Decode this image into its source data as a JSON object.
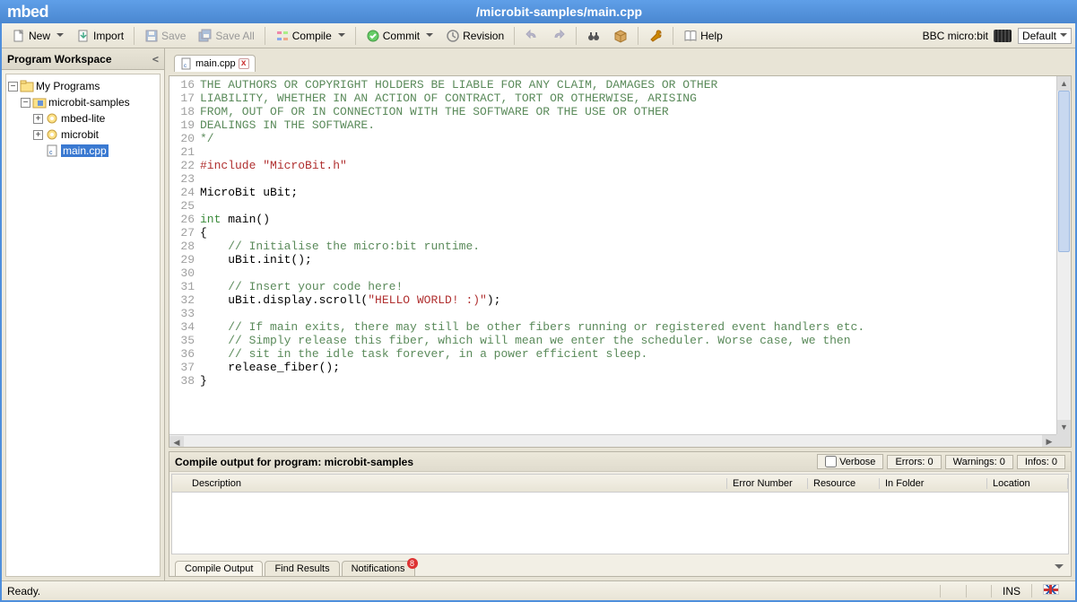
{
  "titlebar": {
    "logo": "mbed",
    "path": "/microbit-samples/main.cpp"
  },
  "toolbar": {
    "new": "New",
    "import": "Import",
    "save": "Save",
    "saveall": "Save All",
    "compile": "Compile",
    "commit": "Commit",
    "revision": "Revision",
    "help": "Help",
    "device": "BBC micro:bit",
    "profile": "Default"
  },
  "sidebar": {
    "title": "Program Workspace",
    "root": "My Programs",
    "proj": "microbit-samples",
    "items": [
      "mbed-lite",
      "microbit",
      "main.cpp"
    ]
  },
  "tab": {
    "name": "main.cpp"
  },
  "code": [
    {
      "n": 16,
      "t": "THE AUTHORS OR COPYRIGHT HOLDERS BE LIABLE FOR ANY CLAIM, DAMAGES OR OTHER",
      "c": "cm"
    },
    {
      "n": 17,
      "t": "LIABILITY, WHETHER IN AN ACTION OF CONTRACT, TORT OR OTHERWISE, ARISING",
      "c": "cm"
    },
    {
      "n": 18,
      "t": "FROM, OUT OF OR IN CONNECTION WITH THE SOFTWARE OR THE USE OR OTHER",
      "c": "cm"
    },
    {
      "n": 19,
      "t": "DEALINGS IN THE SOFTWARE.",
      "c": "cm"
    },
    {
      "n": 20,
      "t": "*/",
      "c": "cm"
    },
    {
      "n": 21,
      "t": "",
      "c": ""
    },
    {
      "n": 22,
      "seg": [
        {
          "t": "#include ",
          "c": "pp"
        },
        {
          "t": "\"MicroBit.h\"",
          "c": "pp"
        }
      ]
    },
    {
      "n": 23,
      "t": "",
      "c": ""
    },
    {
      "n": 24,
      "t": "MicroBit uBit;",
      "c": ""
    },
    {
      "n": 25,
      "t": "",
      "c": ""
    },
    {
      "n": 26,
      "seg": [
        {
          "t": "int",
          "c": "kw"
        },
        {
          "t": " main()",
          "c": ""
        }
      ]
    },
    {
      "n": 27,
      "t": "{",
      "c": ""
    },
    {
      "n": 28,
      "seg": [
        {
          "t": "    ",
          "c": ""
        },
        {
          "t": "// Initialise the micro:bit runtime.",
          "c": "cm"
        }
      ]
    },
    {
      "n": 29,
      "t": "    uBit.init();",
      "c": ""
    },
    {
      "n": 30,
      "t": "",
      "c": ""
    },
    {
      "n": 31,
      "seg": [
        {
          "t": "    ",
          "c": ""
        },
        {
          "t": "// Insert your code here!",
          "c": "cm"
        }
      ]
    },
    {
      "n": 32,
      "seg": [
        {
          "t": "    uBit.display.scroll(",
          "c": ""
        },
        {
          "t": "\"HELLO WORLD! :)\"",
          "c": "st"
        },
        {
          "t": ");",
          "c": ""
        }
      ]
    },
    {
      "n": 33,
      "t": "",
      "c": ""
    },
    {
      "n": 34,
      "seg": [
        {
          "t": "    ",
          "c": ""
        },
        {
          "t": "// If main exits, there may still be other fibers running or registered event handlers etc.",
          "c": "cm"
        }
      ]
    },
    {
      "n": 35,
      "seg": [
        {
          "t": "    ",
          "c": ""
        },
        {
          "t": "// Simply release this fiber, which will mean we enter the scheduler. Worse case, we then",
          "c": "cm"
        }
      ]
    },
    {
      "n": 36,
      "seg": [
        {
          "t": "    ",
          "c": ""
        },
        {
          "t": "// sit in the idle task forever, in a power efficient sleep.",
          "c": "cm"
        }
      ]
    },
    {
      "n": 37,
      "t": "    release_fiber();",
      "c": ""
    },
    {
      "n": 38,
      "t": "}",
      "c": ""
    }
  ],
  "output": {
    "title_prefix": "Compile output for program: ",
    "program": "microbit-samples",
    "verbose": "Verbose",
    "errors": "Errors: 0",
    "warnings": "Warnings: 0",
    "infos": "Infos: 0",
    "cols": {
      "desc": "Description",
      "errnum": "Error Number",
      "res": "Resource",
      "folder": "In Folder",
      "loc": "Location"
    },
    "tabs": {
      "compile": "Compile Output",
      "find": "Find Results",
      "notif": "Notifications"
    },
    "notif_count": "8"
  },
  "status": {
    "ready": "Ready.",
    "ins": "INS"
  }
}
